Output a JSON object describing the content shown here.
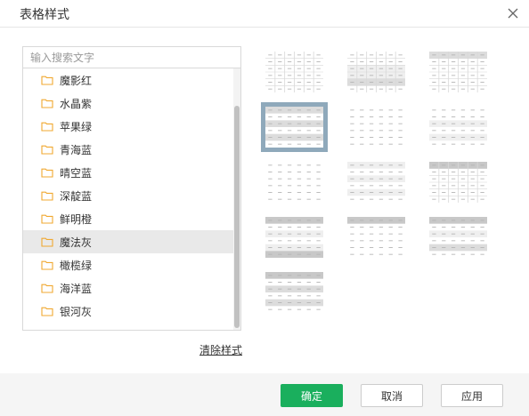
{
  "dialog": {
    "title": "表格样式",
    "close_icon": "close-icon"
  },
  "search": {
    "placeholder": "输入搜索文字",
    "value": ""
  },
  "styles": [
    {
      "label": "魔影红",
      "icon": "folder-icon",
      "selected": false
    },
    {
      "label": "水晶紫",
      "icon": "folder-icon",
      "selected": false
    },
    {
      "label": "苹果绿",
      "icon": "folder-icon",
      "selected": false
    },
    {
      "label": "青海蓝",
      "icon": "folder-icon",
      "selected": false
    },
    {
      "label": "晴空蓝",
      "icon": "folder-icon",
      "selected": false
    },
    {
      "label": "深靛蓝",
      "icon": "folder-icon",
      "selected": false
    },
    {
      "label": "鲜明橙",
      "icon": "folder-icon",
      "selected": false
    },
    {
      "label": "魔法灰",
      "icon": "folder-icon",
      "selected": true
    },
    {
      "label": "橄榄绿",
      "icon": "folder-icon",
      "selected": false
    },
    {
      "label": "海洋蓝",
      "icon": "folder-icon",
      "selected": false
    },
    {
      "label": "银河灰",
      "icon": "folder-icon",
      "selected": false
    }
  ],
  "clear_label": "清除样式",
  "colors": {
    "accent": "#1aaf5d",
    "selection_border": "#8fa9bb",
    "folder": "#f0a830",
    "selected_row": "#e9e9e9"
  },
  "thumbnails": [
    {
      "pattern": "plain-grid",
      "selected": false
    },
    {
      "pattern": "banded-middle",
      "selected": false
    },
    {
      "pattern": "header-shaded",
      "selected": false
    },
    {
      "pattern": "striped-dark",
      "selected": true
    },
    {
      "pattern": "minimal-dashes",
      "selected": false
    },
    {
      "pattern": "alternate-rows",
      "selected": false
    },
    {
      "pattern": "dashes-light",
      "selected": false
    },
    {
      "pattern": "header-light-banded",
      "selected": false
    },
    {
      "pattern": "header-dark-grid",
      "selected": false
    },
    {
      "pattern": "header-footer-dark",
      "selected": false
    },
    {
      "pattern": "header-only",
      "selected": false
    },
    {
      "pattern": "header-dark-banded",
      "selected": false
    },
    {
      "pattern": "all-dark-bands",
      "selected": false
    }
  ],
  "footer": {
    "ok_label": "确定",
    "cancel_label": "取消",
    "apply_label": "应用"
  }
}
